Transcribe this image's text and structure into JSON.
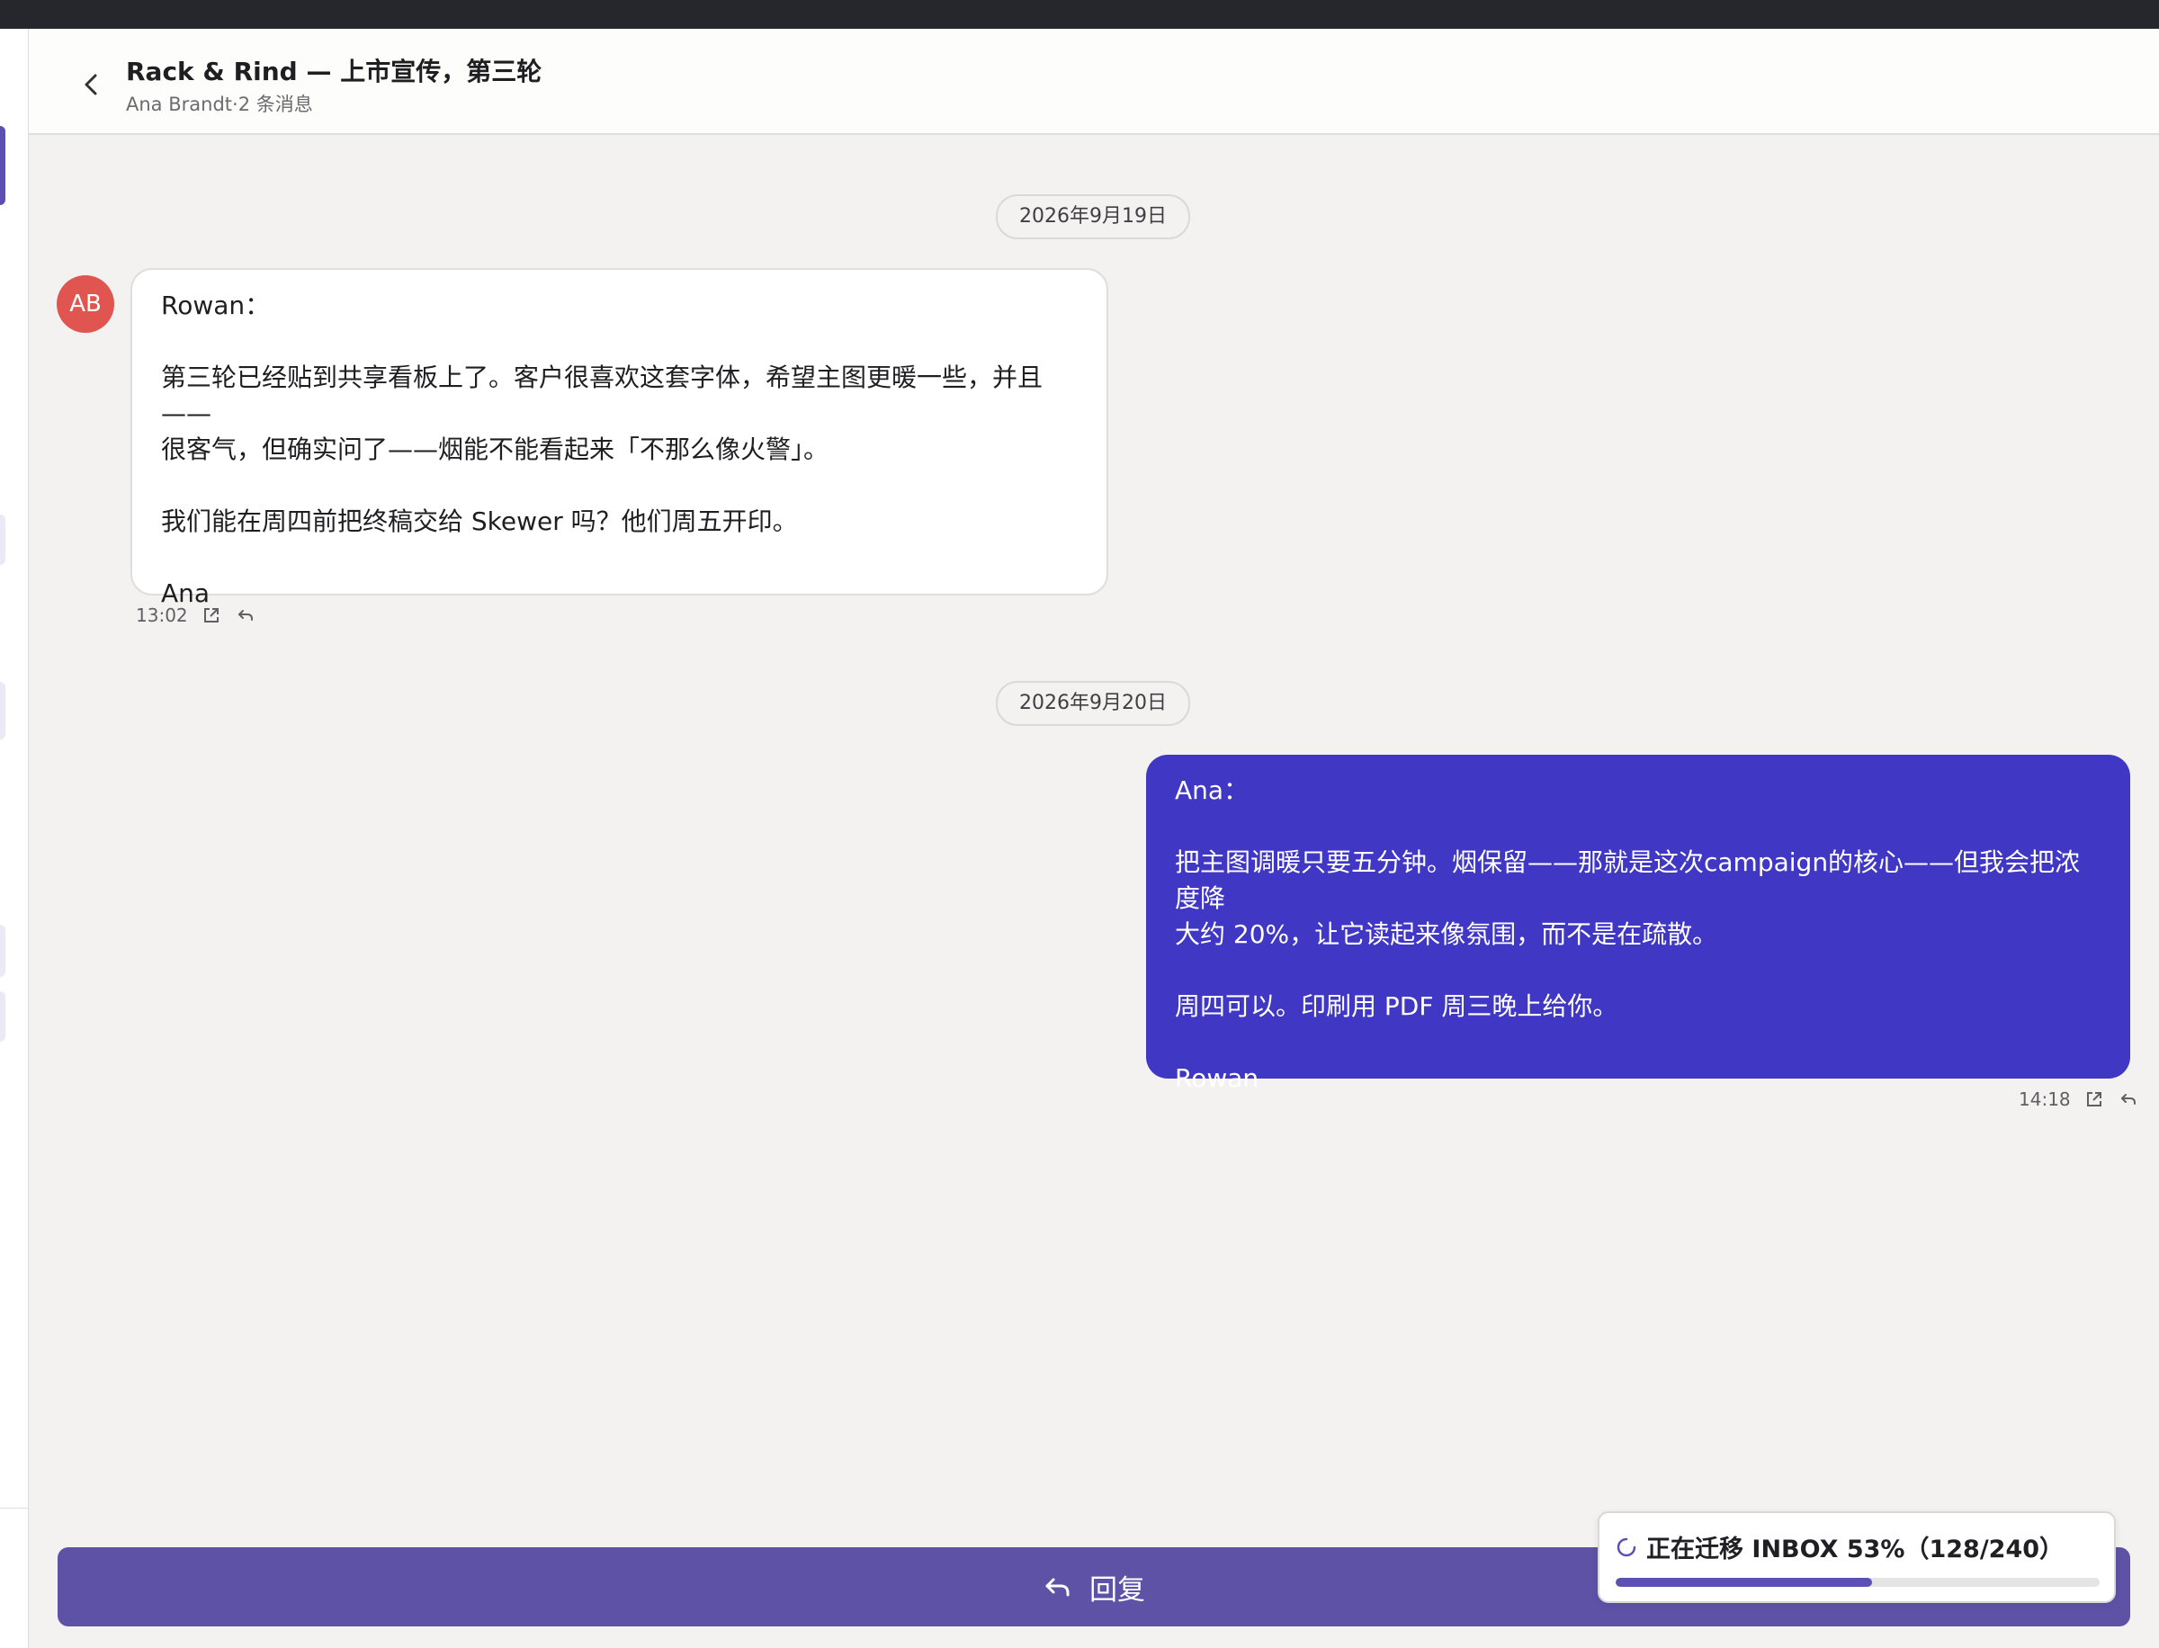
{
  "thread": {
    "title": "Rack & Rind — 上市宣传，第三轮",
    "sender": "Ana Brandt",
    "separator": "·",
    "message_count": "2 条消息"
  },
  "colors": {
    "accent": "#4037c4",
    "reply_button": "#5d52a6",
    "avatar": "#e05550"
  },
  "messages": [
    {
      "date": "2026年9月19日",
      "avatar_initials": "AB",
      "direction": "incoming",
      "lines": [
        "Rowan：",
        "",
        "第三轮已经贴到共享看板上了。客户很喜欢这套字体，希望主图更暖一些，并且——",
        "很客气，但确实问了——烟能不能看起来「不那么像火警」。",
        "",
        "我们能在周四前把终稿交给 Skewer 吗？他们周五开印。",
        "",
        "Ana"
      ],
      "time": "13:02",
      "icons": [
        "open-external-icon",
        "reply-icon"
      ]
    },
    {
      "date": "2026年9月20日",
      "direction": "outgoing",
      "lines": [
        "Ana：",
        "",
        "把主图调暖只要五分钟。烟保留——那就是这次campaign的核心——但我会把浓度降",
        "大约 20%，让它读起来像氛围，而不是在疏散。",
        "",
        "周四可以。印刷用 PDF 周三晚上给你。",
        "",
        "Rowan"
      ],
      "time": "14:18",
      "icons": [
        "open-external-icon",
        "reply-icon"
      ]
    }
  ],
  "reply_button": {
    "label": "回复",
    "icon": "reply-icon"
  },
  "migration": {
    "text": "正在迁移 INBOX 53%（128/240）",
    "progress": 0.53,
    "done": 128,
    "total": 240,
    "icon": "spinner-icon"
  }
}
